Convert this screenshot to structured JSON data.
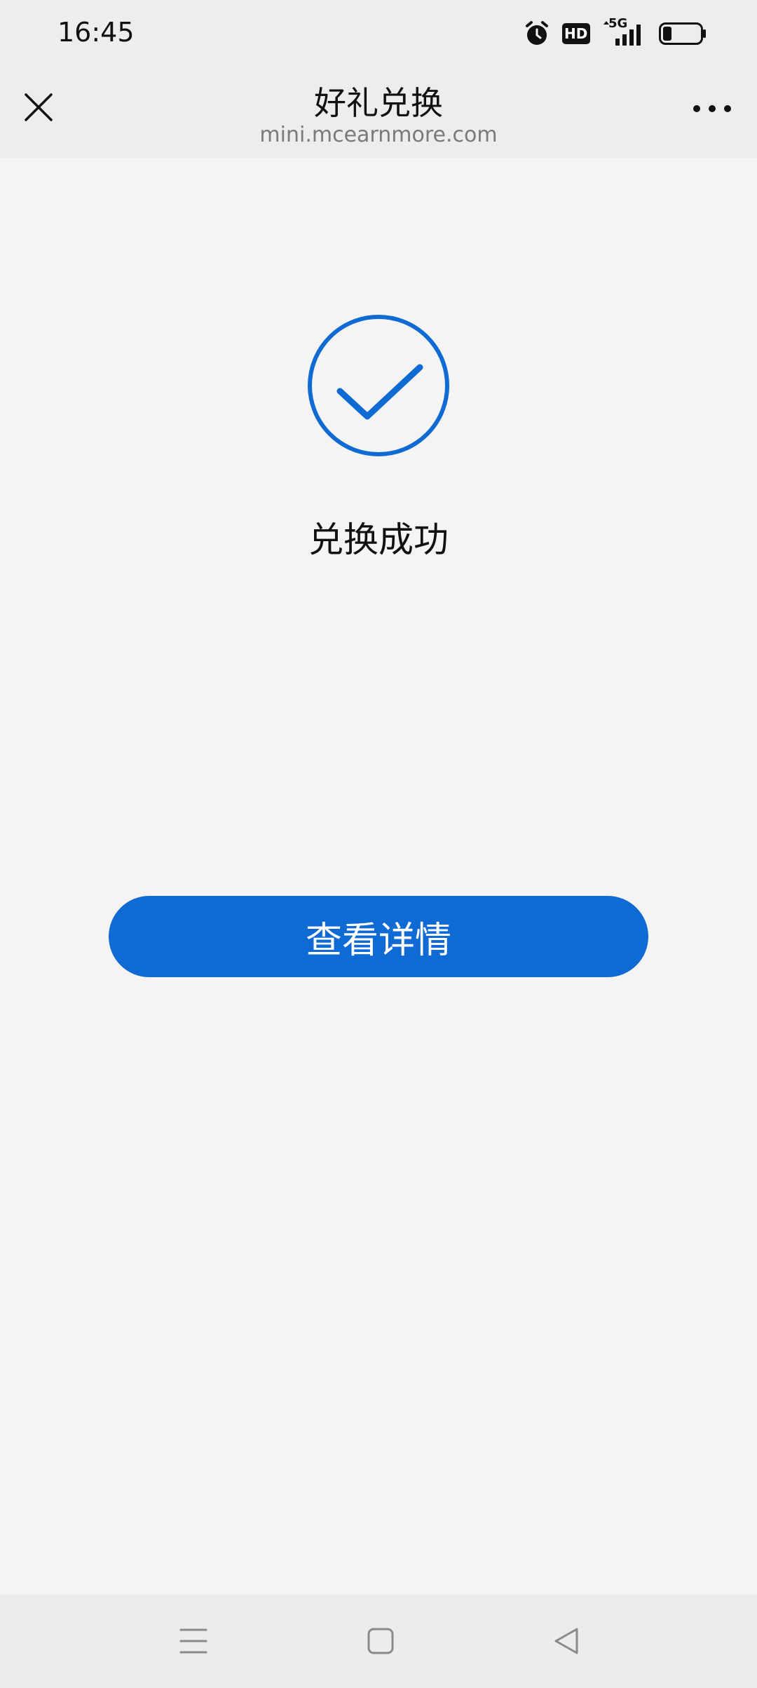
{
  "status_bar": {
    "time": "16:45",
    "icons": [
      "alarm-icon",
      "hd-icon",
      "5g-signal-icon",
      "battery-icon"
    ],
    "hd_label": "HD",
    "network_label": "5G"
  },
  "title_bar": {
    "title": "好礼兑换",
    "subtitle": "mini.mcearnmore.com",
    "close_icon": "close-icon",
    "more_icon": "more-icon"
  },
  "content": {
    "success_icon": "check-circle-icon",
    "success_text": "兑换成功",
    "detail_button_label": "查看详情"
  },
  "nav_bar": {
    "icons": [
      "menu-icon",
      "home-icon",
      "back-icon"
    ]
  },
  "colors": {
    "accent": "#0f6ad3",
    "background": "#f4f4f5",
    "bar_background": "#ededed"
  }
}
